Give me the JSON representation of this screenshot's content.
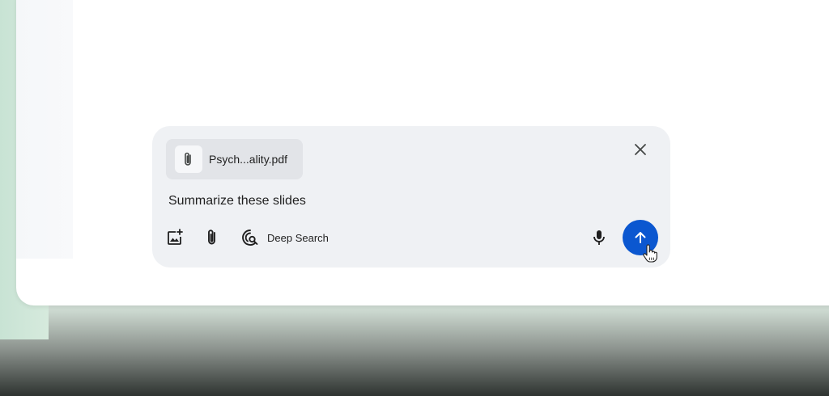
{
  "composer": {
    "attachment": {
      "filename": "Psych...ality.pdf",
      "icon": "paperclip-icon"
    },
    "prompt": "Summarize these slides",
    "tools": {
      "image_icon": "add-image-icon",
      "attach_icon": "paperclip-icon",
      "deep_search_label": "Deep Search",
      "deep_search_icon": "deep-search-icon"
    },
    "mic_icon": "microphone-icon",
    "send_icon": "arrow-up-icon",
    "close_icon": "close-icon"
  },
  "colors": {
    "send_button": "#0b57d0",
    "composer_bg": "#eff1f4",
    "attachment_bg": "#e2e4e8"
  }
}
